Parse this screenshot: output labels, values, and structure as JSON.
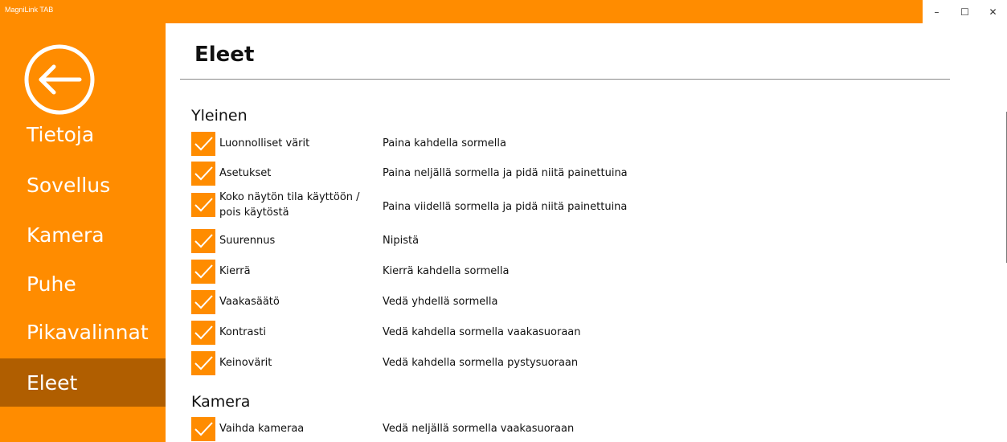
{
  "window": {
    "title": "MagniLink TAB",
    "minimize": "–",
    "maximize": "☐",
    "close": "✕"
  },
  "sidebar": {
    "items": [
      {
        "label": "Tietoja"
      },
      {
        "label": "Sovellus"
      },
      {
        "label": "Kamera"
      },
      {
        "label": "Puhe"
      },
      {
        "label": "Pikavalinnat"
      },
      {
        "label": "Eleet"
      }
    ],
    "active": "Eleet"
  },
  "main": {
    "title": "Eleet",
    "sections": [
      {
        "title": "Yleinen",
        "items": [
          {
            "name": "Luonnolliset värit",
            "desc": "Paina kahdella sormella",
            "checked": true
          },
          {
            "name": "Asetukset",
            "desc": "Paina neljällä sormella ja pidä niitä painettuina",
            "checked": true
          },
          {
            "name": "Koko näytön tila käyttöön / pois käytöstä",
            "desc": "Paina viidellä sormella ja pidä niitä painettuina",
            "checked": true
          },
          {
            "name": "Suurennus",
            "desc": "Nipistä",
            "checked": true
          },
          {
            "name": "Kierrä",
            "desc": "Kierrä kahdella sormella",
            "checked": true
          },
          {
            "name": "Vaakasäätö",
            "desc": "Vedä yhdellä sormella",
            "checked": true
          },
          {
            "name": "Kontrasti",
            "desc": "Vedä kahdella sormella vaakasuoraan",
            "checked": true
          },
          {
            "name": "Keinovärit",
            "desc": "Vedä kahdella sormella pystysuoraan",
            "checked": true
          }
        ]
      },
      {
        "title": "Kamera",
        "items": [
          {
            "name": "Vaihda kameraa",
            "desc": "Vedä neljällä sormella vaakasuoraan",
            "checked": true
          }
        ]
      }
    ]
  },
  "colors": {
    "accent": "#ff8c00",
    "active_nav": "#b05e00",
    "text": "#111111"
  }
}
